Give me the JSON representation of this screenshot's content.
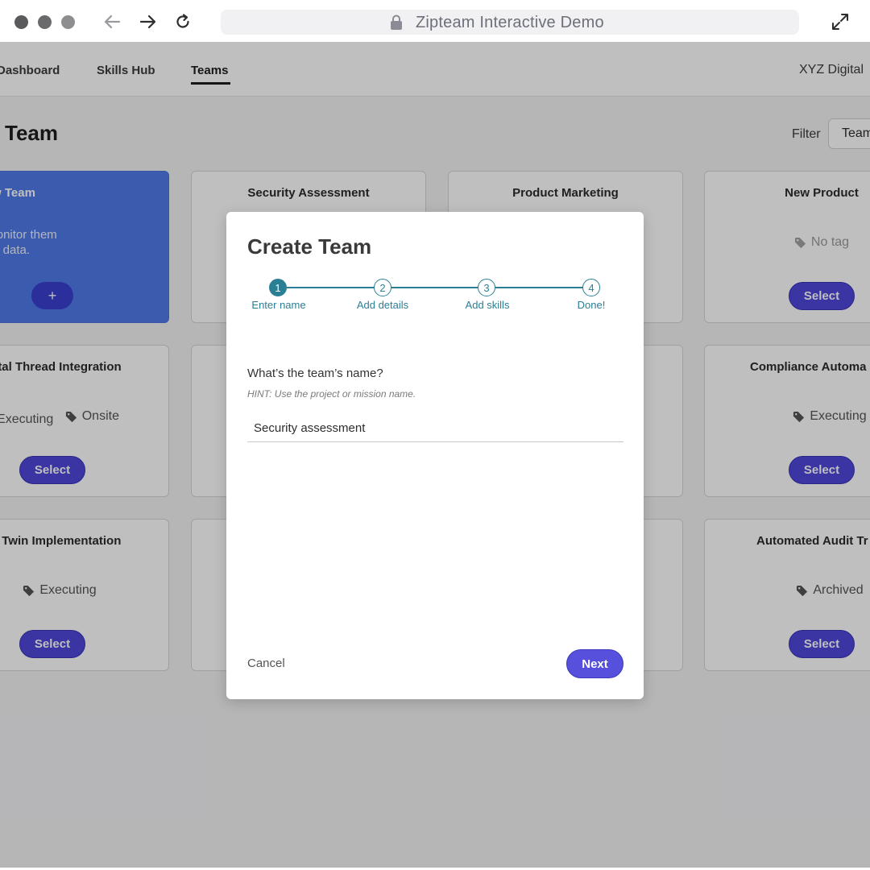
{
  "browser": {
    "url_title": "Zipteam Interactive Demo",
    "icons": [
      "window-dot-icon",
      "back-arrow-icon",
      "forward-arrow-icon",
      "reload-icon",
      "lock-icon",
      "expand-icon"
    ]
  },
  "nav": {
    "items": [
      {
        "label": "Dashboard"
      },
      {
        "label": "Skills Hub"
      },
      {
        "label": "Teams"
      }
    ],
    "active": "Teams",
    "org": "XYZ Digital"
  },
  "page": {
    "title": "Team",
    "filter_label": "Filter",
    "filter_value": "Team"
  },
  "cards": {
    "create": {
      "title": "Create New Team",
      "desc_line1": "ew team and monitor them",
      "desc_line2": "using skills data.",
      "button": "+"
    },
    "select_label": "Select",
    "security": {
      "title": "Security Assessment"
    },
    "product_marketing": {
      "title": "Product Marketing"
    },
    "new_product": {
      "title": "New Product",
      "tag": "No tag"
    },
    "thread": {
      "title": "tal Thread Integration",
      "tag1": "Executing",
      "tag2": "Onsite"
    },
    "compliance": {
      "title": "Compliance Automa",
      "tag": "Executing"
    },
    "twin": {
      "title": "al Twin Implementation",
      "tag": "Executing"
    },
    "audit": {
      "title": "Automated Audit Tr",
      "tag": "Archived"
    }
  },
  "modal": {
    "title": "Create Team",
    "steps": [
      {
        "num": "1",
        "label": "Enter name"
      },
      {
        "num": "2",
        "label": "Add details"
      },
      {
        "num": "3",
        "label": "Add skills"
      },
      {
        "num": "4",
        "label": "Done!"
      }
    ],
    "current_step": 1,
    "question": "What’s the team’s name?",
    "hint": "HINT: Use the project or mission name.",
    "input_value": "Security assessment",
    "cancel": "Cancel",
    "next": "Next"
  },
  "colors": {
    "accent": "#4e47d8",
    "create_card": "#4f7ae8",
    "stepper": "#2b7f95"
  }
}
